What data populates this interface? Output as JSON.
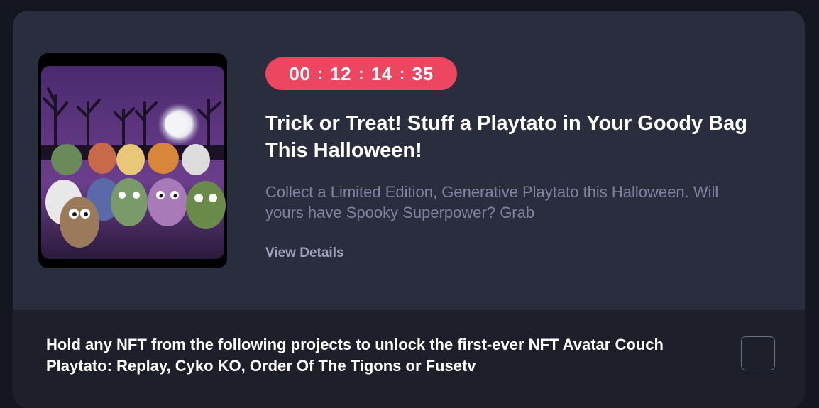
{
  "event": {
    "timer": {
      "hours": "00",
      "minutes": "12",
      "seconds": "14",
      "frames": "35",
      "separator": ":",
      "color": "#ec4660"
    },
    "title": "Trick or Treat! Stuff a Playtato in Your Goody Bag This Halloween!",
    "description": "Collect a Limited Edition, Generative Playtato this Halloween. Will yours have Spooky Superpower? Grab",
    "details_link": "View Details",
    "image_icon": "halloween-playtato-artwork"
  },
  "unlock": {
    "text": "Hold any NFT from the following projects to unlock the first-ever NFT Avatar Couch Playtato: Replay, Cyko KO, Order Of The Tigons or Fusetv",
    "checkbox_checked": false
  },
  "colors": {
    "background": "#151720",
    "card": "#2a2d3e",
    "footer": "#1d1f2a",
    "accent": "#ec4660",
    "muted_text": "#7f839d"
  }
}
